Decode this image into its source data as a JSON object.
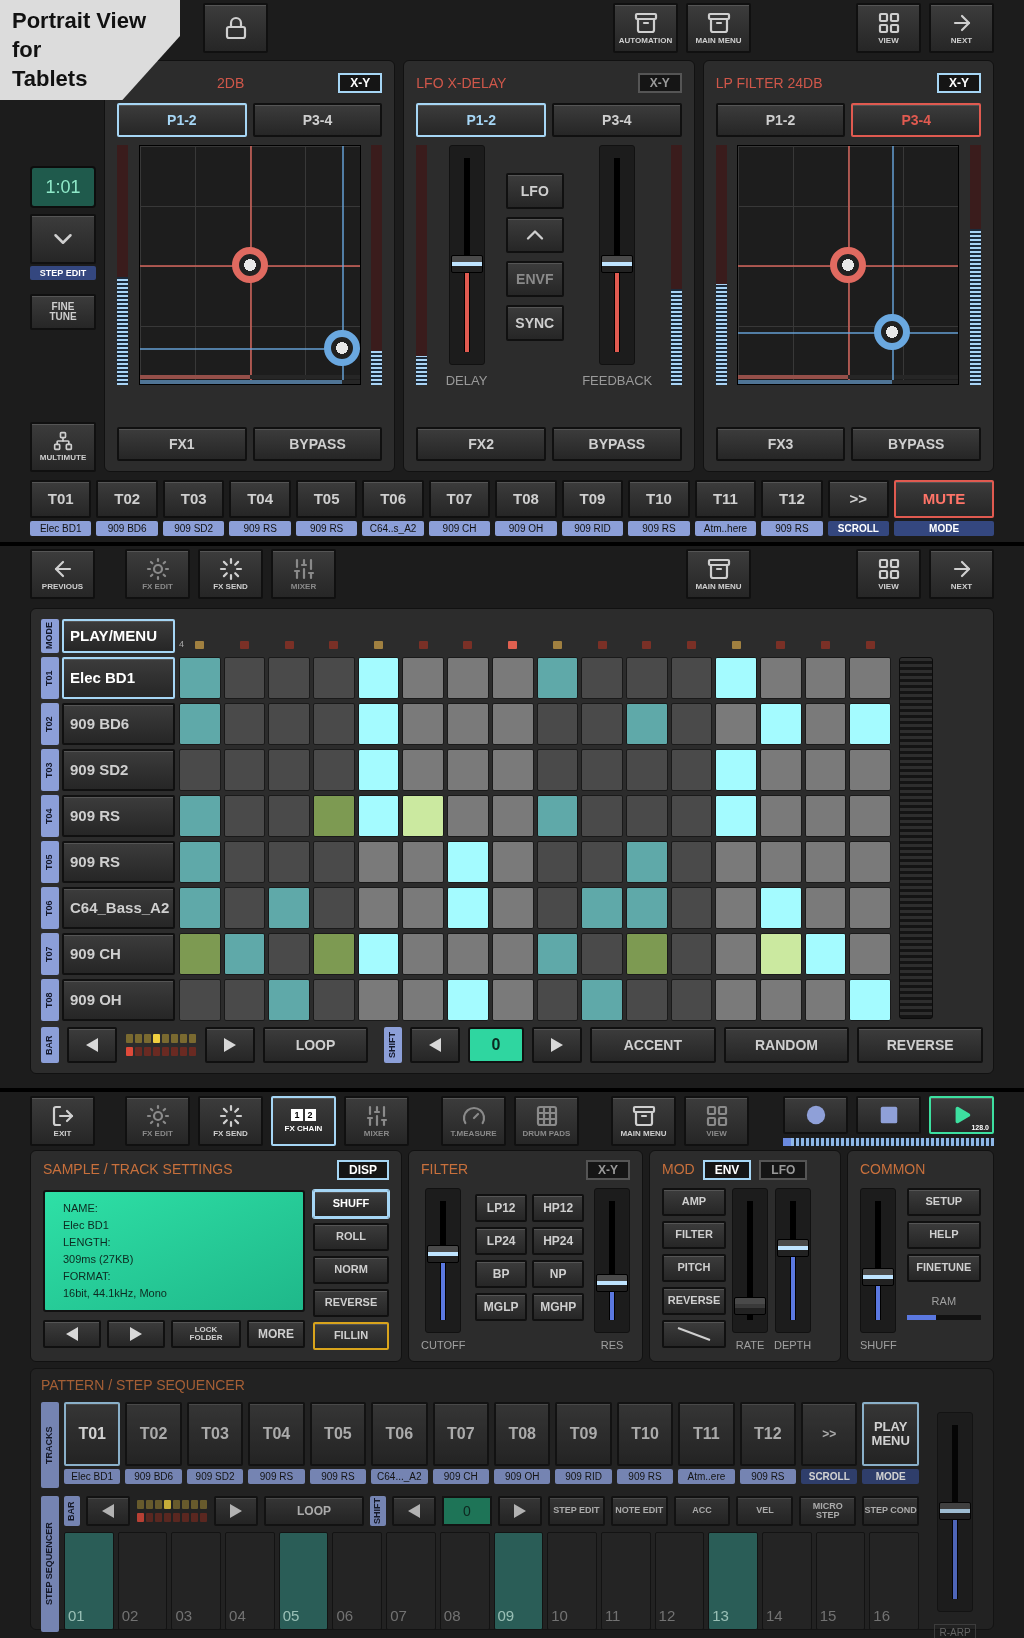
{
  "banner": {
    "lines": [
      "Portrait View",
      "for",
      "Tablets"
    ]
  },
  "top_bar": {
    "groups": [
      [
        {
          "kind": "lock"
        }
      ],
      [
        {
          "kind": "automation",
          "label": "AUTOMATION"
        },
        {
          "kind": "menu",
          "label": "MAIN MENU"
        }
      ],
      [
        {
          "kind": "view",
          "label": "VIEW"
        },
        {
          "kind": "next",
          "label": "NEXT"
        }
      ]
    ]
  },
  "side": {
    "position": "1:01",
    "step_caption": "STEP EDIT",
    "fine_tune": "FINE TUNE",
    "multimute": "MULTIMUTE"
  },
  "fx_panels": [
    {
      "kind": "xy",
      "title": "2DB",
      "badge": {
        "label": "X-Y",
        "on": true
      },
      "color": "#a6d6f5",
      "pages": [
        {
          "label": "P1-2",
          "selected": true
        },
        {
          "label": "P3-4",
          "selected": false
        }
      ],
      "meters": [
        {
          "level": 0.45
        },
        {
          "level": 0.14
        }
      ],
      "pucks": [
        {
          "color": "#e06a60",
          "x": {
            "level": 0.5
          },
          "y": {
            "level": 0.5
          }
        },
        {
          "color": "#6aa8e0",
          "x": {
            "level": 0.92
          },
          "y": {
            "level": 0.15
          }
        }
      ],
      "buttons": [
        "FX1",
        "BYPASS"
      ]
    },
    {
      "kind": "delay",
      "title": "LFO X-DELAY",
      "badge": {
        "label": "X-Y",
        "on": false
      },
      "color": "#a6d6f5",
      "pages": [
        {
          "label": "P1-2",
          "selected": true
        },
        {
          "label": "P3-4",
          "selected": false
        }
      ],
      "meters": [
        {
          "level": 0.12
        },
        {
          "level": 0.4
        }
      ],
      "sliders": [
        {
          "label": "DELAY",
          "level": 0.45
        },
        {
          "label": "FEEDBACK",
          "level": 0.45
        }
      ],
      "modes": [
        {
          "kind": "text",
          "label": "LFO",
          "disabled": false
        },
        {
          "kind": "shape",
          "disabled": false
        },
        {
          "kind": "text",
          "label": "ENVF",
          "disabled": true
        },
        {
          "kind": "text",
          "label": "SYNC",
          "disabled": false
        }
      ],
      "buttons": [
        "FX2",
        "BYPASS"
      ]
    },
    {
      "kind": "xy",
      "title": "LP FILTER 24DB",
      "badge": {
        "label": "X-Y",
        "on": true
      },
      "color": "#e05a50",
      "pages": [
        {
          "label": "P1-2",
          "selected": false
        },
        {
          "label": "P3-4",
          "selected": true
        }
      ],
      "meters": [
        {
          "level": 0.42
        },
        {
          "level": 0.65
        }
      ],
      "pucks": [
        {
          "color": "#e06a60",
          "x": {
            "level": 0.5
          },
          "y": {
            "level": 0.5
          }
        },
        {
          "color": "#6aa8e0",
          "x": {
            "level": 0.7
          },
          "y": {
            "level": 0.22
          }
        }
      ],
      "buttons": [
        "FX3",
        "BYPASS"
      ]
    }
  ],
  "tracks": [
    {
      "label": "T01",
      "name": "Elec BD1"
    },
    {
      "label": "T02",
      "name": "909 BD6"
    },
    {
      "label": "T03",
      "name": "909 SD2"
    },
    {
      "label": "T04",
      "name": "909 RS"
    },
    {
      "label": "T05",
      "name": "909 RS"
    },
    {
      "label": "T06",
      "name": "C64..s_A2"
    },
    {
      "label": "T07",
      "name": "909 CH"
    },
    {
      "label": "T08",
      "name": "909 OH"
    },
    {
      "label": "T09",
      "name": "909 RID"
    },
    {
      "label": "T10",
      "name": "909 RS"
    },
    {
      "label": "T11",
      "name": "Atm..here"
    },
    {
      "label": "T12",
      "name": "909 RS"
    }
  ],
  "track_scroll": {
    "label": ">>",
    "caption": "SCROLL"
  },
  "track_mode": {
    "label": "MUTE",
    "caption": "MODE",
    "active": true
  },
  "seq_bar": {
    "groups": [
      [
        {
          "kind": "back",
          "label": "PREVIOUS",
          "disabled": false
        }
      ],
      [
        {
          "kind": "fx_edit",
          "label": "FX EDIT",
          "disabled": true
        },
        {
          "kind": "fx_send",
          "label": "FX SEND",
          "disabled": false
        },
        {
          "kind": "mixer",
          "label": "MIXER",
          "disabled": true
        }
      ],
      [
        {
          "kind": "menu",
          "label": "MAIN MENU",
          "disabled": false
        }
      ],
      [
        {
          "kind": "view",
          "label": "VIEW",
          "disabled": false
        },
        {
          "kind": "next",
          "label": "NEXT",
          "disabled": false
        }
      ]
    ]
  },
  "grid": {
    "mode_tag": "MODE",
    "mode": "PLAY/MENU",
    "bar_marker": "4",
    "leds": [
      {
        "color": "#a08040"
      },
      {
        "color": "#7a3026"
      },
      {
        "color": "#7a3026"
      },
      {
        "color": "#7a3026"
      },
      {
        "color": "#a08040"
      },
      {
        "color": "#7a3026"
      },
      {
        "color": "#7a3026"
      },
      {
        "color": "#e06050"
      },
      {
        "color": "#a08040"
      },
      {
        "color": "#7a3026"
      },
      {
        "color": "#7a3026"
      },
      {
        "color": "#7a3026"
      },
      {
        "color": "#a08040"
      },
      {
        "color": "#7a3026"
      },
      {
        "color": "#7a3026"
      },
      {
        "color": "#7a3026"
      }
    ],
    "rows": [
      {
        "tag": "T01",
        "name": "Elec BD1",
        "selected": true,
        "steps": [
          {
            "on": true,
            "color": "#5fa9a9"
          },
          {
            "on": false
          },
          {
            "on": false
          },
          {
            "on": false
          },
          {
            "on": true,
            "color": "#a4fbff"
          },
          {
            "on": false
          },
          {
            "on": false
          },
          {
            "on": false
          },
          {
            "on": true,
            "color": "#5fa9a9"
          },
          {
            "on": false
          },
          {
            "on": false
          },
          {
            "on": false
          },
          {
            "on": true,
            "color": "#a4fbff"
          },
          {
            "on": false
          },
          {
            "on": false
          },
          {
            "on": false
          }
        ]
      },
      {
        "tag": "T02",
        "name": "909 BD6",
        "selected": false,
        "steps": [
          {
            "on": true,
            "color": "#5fa9a9"
          },
          {
            "on": false
          },
          {
            "on": false
          },
          {
            "on": false
          },
          {
            "on": true,
            "color": "#a4fbff"
          },
          {
            "on": false
          },
          {
            "on": false
          },
          {
            "on": false
          },
          {
            "on": false
          },
          {
            "on": false
          },
          {
            "on": true,
            "color": "#5fa9a9"
          },
          {
            "on": false
          },
          {
            "on": false
          },
          {
            "on": true,
            "color": "#a4fbff"
          },
          {
            "on": false
          },
          {
            "on": true,
            "color": "#a4fbff"
          }
        ]
      },
      {
        "tag": "T03",
        "name": "909 SD2",
        "selected": false,
        "steps": [
          {
            "on": false
          },
          {
            "on": false
          },
          {
            "on": false
          },
          {
            "on": false
          },
          {
            "on": true,
            "color": "#a4fbff"
          },
          {
            "on": false
          },
          {
            "on": false
          },
          {
            "on": false
          },
          {
            "on": false
          },
          {
            "on": false
          },
          {
            "on": false
          },
          {
            "on": false
          },
          {
            "on": true,
            "color": "#a4fbff"
          },
          {
            "on": false
          },
          {
            "on": false
          },
          {
            "on": false
          }
        ]
      },
      {
        "tag": "T04",
        "name": "909 RS",
        "selected": false,
        "steps": [
          {
            "on": true,
            "color": "#5fa9a9"
          },
          {
            "on": false
          },
          {
            "on": false
          },
          {
            "on": true,
            "color": "#7d9a52"
          },
          {
            "on": true,
            "color": "#a4fbff"
          },
          {
            "on": true,
            "color": "#cbe9a0"
          },
          {
            "on": false
          },
          {
            "on": false
          },
          {
            "on": true,
            "color": "#5fa9a9"
          },
          {
            "on": false
          },
          {
            "on": false
          },
          {
            "on": false
          },
          {
            "on": true,
            "color": "#a4fbff"
          },
          {
            "on": false
          },
          {
            "on": false
          },
          {
            "on": false
          }
        ]
      },
      {
        "tag": "T05",
        "name": "909 RS",
        "selected": false,
        "steps": [
          {
            "on": true,
            "color": "#5fa9a9"
          },
          {
            "on": false
          },
          {
            "on": false
          },
          {
            "on": false
          },
          {
            "on": false
          },
          {
            "on": false
          },
          {
            "on": true,
            "color": "#a4fbff"
          },
          {
            "on": false
          },
          {
            "on": false
          },
          {
            "on": false
          },
          {
            "on": true,
            "color": "#5fa9a9"
          },
          {
            "on": false
          },
          {
            "on": false
          },
          {
            "on": false
          },
          {
            "on": false
          },
          {
            "on": false
          }
        ]
      },
      {
        "tag": "T06",
        "name": "C64_Bass_A2",
        "selected": false,
        "steps": [
          {
            "on": true,
            "color": "#5fa9a9"
          },
          {
            "on": false
          },
          {
            "on": true,
            "color": "#5fa9a9"
          },
          {
            "on": false
          },
          {
            "on": false
          },
          {
            "on": false
          },
          {
            "on": true,
            "color": "#a4fbff"
          },
          {
            "on": false
          },
          {
            "on": false
          },
          {
            "on": true,
            "color": "#5fa9a9"
          },
          {
            "on": true,
            "color": "#5fa9a9"
          },
          {
            "on": false
          },
          {
            "on": false
          },
          {
            "on": true,
            "color": "#a4fbff"
          },
          {
            "on": false
          },
          {
            "on": false
          }
        ]
      },
      {
        "tag": "T07",
        "name": "909 CH",
        "selected": false,
        "steps": [
          {
            "on": true,
            "color": "#7d9a52"
          },
          {
            "on": true,
            "color": "#5fa9a9"
          },
          {
            "on": false
          },
          {
            "on": true,
            "color": "#7d9a52"
          },
          {
            "on": true,
            "color": "#a4fbff"
          },
          {
            "on": false
          },
          {
            "on": false
          },
          {
            "on": false
          },
          {
            "on": true,
            "color": "#5fa9a9"
          },
          {
            "on": false
          },
          {
            "on": true,
            "color": "#7d9a52"
          },
          {
            "on": false
          },
          {
            "on": false
          },
          {
            "on": true,
            "color": "#cbe9a0"
          },
          {
            "on": true,
            "color": "#a4fbff"
          },
          {
            "on": false
          }
        ]
      },
      {
        "tag": "T08",
        "name": "909 OH",
        "selected": false,
        "steps": [
          {
            "on": false
          },
          {
            "on": false
          },
          {
            "on": true,
            "color": "#5fa9a9"
          },
          {
            "on": false
          },
          {
            "on": false
          },
          {
            "on": false
          },
          {
            "on": true,
            "color": "#a4fbff"
          },
          {
            "on": false
          },
          {
            "on": false
          },
          {
            "on": true,
            "color": "#5fa9a9"
          },
          {
            "on": false
          },
          {
            "on": false
          },
          {
            "on": false
          },
          {
            "on": false
          },
          {
            "on": false
          },
          {
            "on": true,
            "color": "#a4fbff"
          }
        ]
      }
    ],
    "bar_tag": "BAR",
    "loop": "LOOP",
    "shift_tag": "SHIFT",
    "shift_value": "0",
    "actions": [
      "ACCENT",
      "RANDOM",
      "REVERSE"
    ]
  },
  "main_bar": {
    "groups": [
      [
        {
          "kind": "exit",
          "label": "EXIT",
          "disabled": false,
          "selected": false
        }
      ],
      [
        {
          "kind": "fx_edit",
          "label": "FX EDIT",
          "disabled": true,
          "selected": false
        },
        {
          "kind": "fx_send",
          "label": "FX SEND",
          "disabled": false,
          "selected": false
        },
        {
          "kind": "chain",
          "label": "FX CHAIN",
          "digits": [
            "1",
            "2"
          ],
          "disabled": false,
          "selected": true
        },
        {
          "kind": "mixer",
          "label": "MIXER",
          "disabled": true,
          "selected": false
        }
      ],
      [
        {
          "kind": "measure",
          "label": "T.MEASURE",
          "disabled": true,
          "selected": false
        },
        {
          "kind": "pads",
          "label": "DRUM PADS",
          "disabled": true,
          "selected": false
        }
      ],
      [
        {
          "kind": "menu",
          "label": "MAIN MENU",
          "disabled": false,
          "selected": false
        },
        {
          "kind": "view",
          "label": "VIEW",
          "disabled": true,
          "selected": false
        }
      ]
    ],
    "transport": [
      {
        "kind": "record",
        "active": false
      },
      {
        "kind": "stop",
        "active": false
      },
      {
        "kind": "play",
        "active": true,
        "tempo": "128.0"
      }
    ]
  },
  "sample": {
    "title": "SAMPLE / TRACK SETTINGS",
    "badge": {
      "label": "DISP",
      "on": true
    },
    "info": [
      "NAME:",
      "Elec BD1",
      "LENGTH:",
      "309ms (27KB)",
      "FORMAT:",
      "16bit, 44.1kHz, Mono"
    ],
    "options": [
      {
        "label": "SHUFF",
        "selected": true,
        "armed": false
      },
      {
        "label": "ROLL",
        "selected": false,
        "armed": false
      },
      {
        "label": "NORM",
        "selected": false,
        "armed": false
      },
      {
        "label": "REVERSE",
        "selected": false,
        "armed": false
      },
      {
        "label": "FILLIN",
        "selected": false,
        "armed": true
      }
    ],
    "nav": [
      {
        "kind": "prev"
      },
      {
        "kind": "next"
      },
      {
        "kind": "text",
        "label": "LOCK FOLDER"
      },
      {
        "kind": "text",
        "label": "MORE"
      }
    ]
  },
  "filter": {
    "title": "FILTER",
    "badge": {
      "label": "X-Y",
      "on": false
    },
    "sliders": [
      {
        "label": "CUTOFF",
        "level": 0.55
      },
      {
        "label": "RES",
        "level": 0.3
      }
    ],
    "types": [
      "LP12",
      "HP12",
      "LP24",
      "HP24",
      "BP",
      "NP",
      "MGLP",
      "MGHP"
    ]
  },
  "mod": {
    "title": "MOD",
    "tabs": [
      {
        "label": "ENV",
        "selected": true
      },
      {
        "label": "LFO",
        "selected": false
      }
    ],
    "targets": [
      {
        "kind": "text",
        "label": "AMP"
      },
      {
        "kind": "text",
        "label": "FILTER"
      },
      {
        "kind": "text",
        "label": "PITCH"
      },
      {
        "kind": "text",
        "label": "REVERSE"
      },
      {
        "kind": "shape"
      }
    ],
    "sliders": [
      {
        "label": "RATE",
        "level": 0.1,
        "disabled": true
      },
      {
        "label": "DEPTH",
        "level": 0.6,
        "disabled": false
      }
    ]
  },
  "common": {
    "title": "COMMON",
    "slider": {
      "label": "SHUFF",
      "level": 0.35
    },
    "buttons": [
      "SETUP",
      "HELP",
      "FINETUNE"
    ],
    "ram": {
      "label": "RAM",
      "level": 0.4
    }
  },
  "pattern": {
    "title": "PATTERN / STEP SEQUENCER",
    "tracks_tag": "TRACKS",
    "tracks": [
      {
        "label": "T01",
        "name": "Elec BD1",
        "selected": true
      },
      {
        "label": "T02",
        "name": "909 BD6",
        "selected": false
      },
      {
        "label": "T03",
        "name": "909 SD2",
        "selected": false
      },
      {
        "label": "T04",
        "name": "909 RS",
        "selected": false
      },
      {
        "label": "T05",
        "name": "909 RS",
        "selected": false
      },
      {
        "label": "T06",
        "name": "C64..._A2",
        "selected": false
      },
      {
        "label": "T07",
        "name": "909 CH",
        "selected": false
      },
      {
        "label": "T08",
        "name": "909 OH",
        "selected": false
      },
      {
        "label": "T09",
        "name": "909 RID",
        "selected": false
      },
      {
        "label": "T10",
        "name": "909 RS",
        "selected": false
      },
      {
        "label": "T11",
        "name": "Atm..ere",
        "selected": false
      },
      {
        "label": "T12",
        "name": "909 RS",
        "selected": false
      }
    ],
    "scroll": {
      "label": ">>",
      "caption": "SCROLL"
    },
    "mode": {
      "label": "PLAY MENU",
      "caption": "MODE"
    },
    "seq_tag": "STEP SEQUENCER",
    "bar_tag": "BAR",
    "loop": "LOOP",
    "shift_tag": "SHIFT",
    "shift_value": "0",
    "edit_buttons": [
      "STEP EDIT",
      "NOTE EDIT",
      "ACC",
      "VEL",
      "MICRO STEP",
      "STEP COND"
    ],
    "steps": [
      {
        "label": "01",
        "on": true
      },
      {
        "label": "02",
        "on": false
      },
      {
        "label": "03",
        "on": false
      },
      {
        "label": "04",
        "on": false
      },
      {
        "label": "05",
        "on": true
      },
      {
        "label": "06",
        "on": false
      },
      {
        "label": "07",
        "on": false
      },
      {
        "label": "08",
        "on": false
      },
      {
        "label": "09",
        "on": true
      },
      {
        "label": "10",
        "on": false
      },
      {
        "label": "11",
        "on": false
      },
      {
        "label": "12",
        "on": false
      },
      {
        "label": "13",
        "on": true
      },
      {
        "label": "14",
        "on": false
      },
      {
        "label": "15",
        "on": false
      },
      {
        "label": "16",
        "on": false
      }
    ],
    "volume": {
      "level": 0.5
    },
    "arp": "R-ARP"
  }
}
